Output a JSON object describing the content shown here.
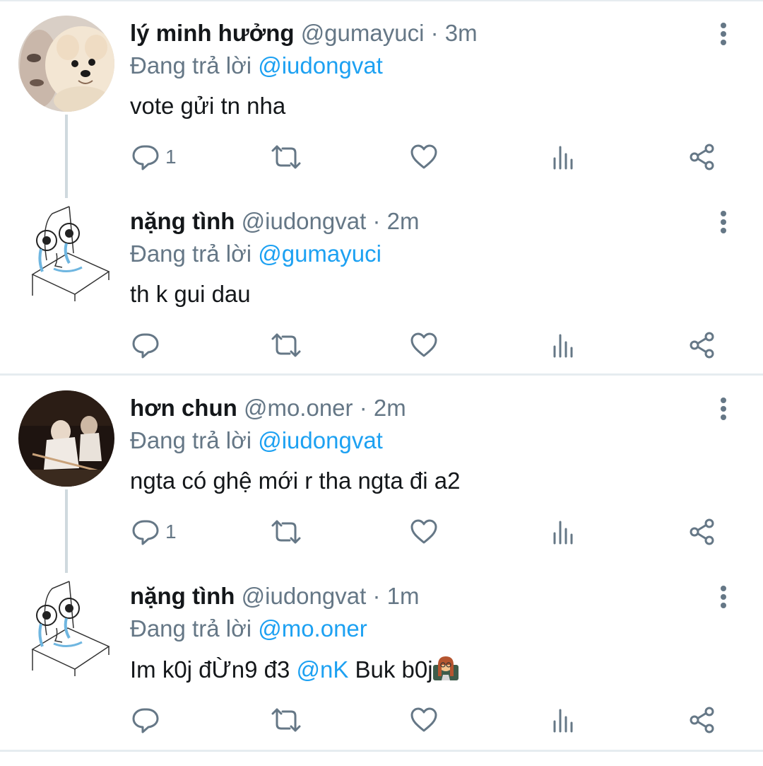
{
  "tweets": [
    {
      "name": "lý minh hưởng",
      "handle": "@gumayuci",
      "dot": "·",
      "time": "3m",
      "reply_prefix": "Đang trả lời",
      "reply_to": "@iudongvat",
      "text": "vote gửi tn nha",
      "reply_count": "1",
      "avatar": "pomeranian-dog-photo"
    },
    {
      "name": "nặng tình",
      "handle": "@iudongvat",
      "dot": "·",
      "time": "2m",
      "reply_prefix": "Đang trả lời",
      "reply_to": "@gumayuci",
      "text": "th k gui dau",
      "reply_count": "",
      "avatar": "crying-sketch-drawing"
    },
    {
      "name": "hơn chun",
      "handle": "@mo.oner",
      "dot": "·",
      "time": "2m",
      "reply_prefix": "Đang trả lời",
      "reply_to": "@iudongvat",
      "text": "ngta có ghệ mới r tha ngta đi a2",
      "reply_count": "1",
      "avatar": "billiards-photo"
    },
    {
      "name": "nặng tình",
      "handle": "@iudongvat",
      "dot": "·",
      "time": "1m",
      "reply_prefix": "Đang trả lời",
      "reply_to": "@mo.oner",
      "text_before": "Im k0j đỪn9 đ3",
      "text_mention": "@nK",
      "text_after": "Buk b0j",
      "reply_count": "",
      "avatar": "crying-sketch-drawing",
      "emoji": "teacher-emoji"
    }
  ],
  "icons": {
    "reply": "reply-icon",
    "retweet": "retweet-icon",
    "like": "heart-icon",
    "views": "views-icon",
    "share": "share-icon",
    "more": "more-vertical-icon"
  },
  "colors": {
    "mention": "#1da1f2",
    "secondary": "#657786",
    "divider": "#e6ecf0",
    "connector": "#cfd9de"
  }
}
